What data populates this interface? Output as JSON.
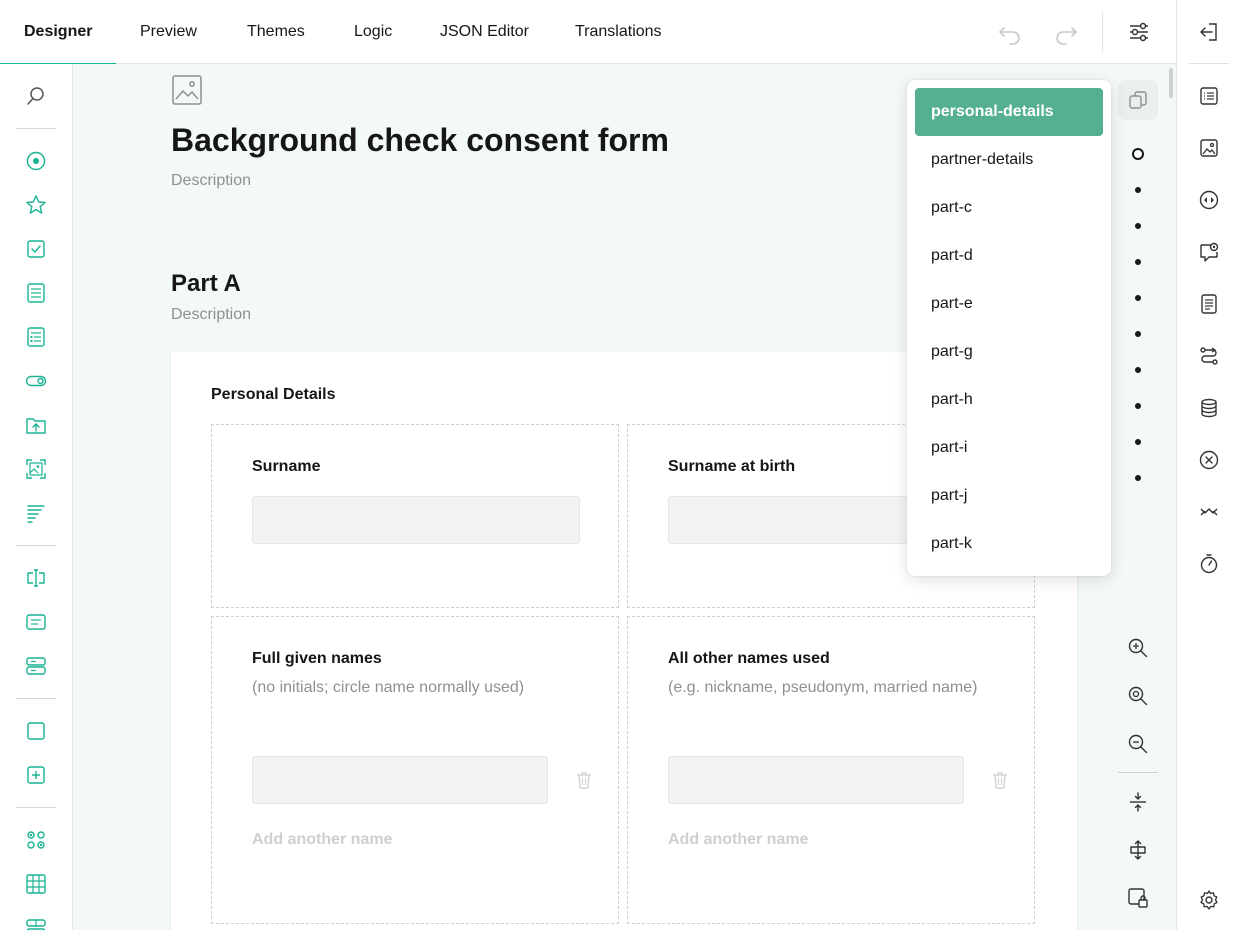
{
  "colors": {
    "accent": "#19b394",
    "selected_item": "#55b092",
    "canvas_bg": "#f3f9f8"
  },
  "tabs": [
    {
      "label": "Designer",
      "active": true
    },
    {
      "label": "Preview",
      "active": false
    },
    {
      "label": "Themes",
      "active": false
    },
    {
      "label": "Logic",
      "active": false
    },
    {
      "label": "JSON Editor",
      "active": false
    },
    {
      "label": "Translations",
      "active": false
    }
  ],
  "top_actions": [
    "undo-icon",
    "redo-icon",
    "settings-sliders-icon"
  ],
  "toolbox_icons": [
    "search-icon",
    "radiogroup-icon",
    "rating-star-icon",
    "checkbox-icon",
    "dropdown-icon",
    "tagbox-icon",
    "boolean-toggle-icon",
    "file-upload-icon",
    "image-picker-icon",
    "ranking-icon",
    "single-input-icon",
    "comment-icon",
    "multiple-text-icon",
    "panel-icon",
    "panel-dynamic-icon",
    "matrix-icon",
    "matrix-grid-icon",
    "matrix-dynamic-icon"
  ],
  "form": {
    "title": "Background check consent form",
    "description": "Description"
  },
  "page": {
    "title": "Part A",
    "description": "Description"
  },
  "panel": {
    "title": "Personal Details",
    "questions": [
      {
        "title": "Surname",
        "description": ""
      },
      {
        "title": "Surname at birth",
        "description": ""
      },
      {
        "title": "Full given names",
        "description": "(no initials; circle name normally used)",
        "add_label": "Add another name"
      },
      {
        "title": "All other names used",
        "description": "(e.g. nickname, pseudonym, married name)",
        "add_label": "Add another name"
      }
    ]
  },
  "page_dropdown": {
    "items": [
      "personal-details",
      "partner-details",
      "part-c",
      "part-d",
      "part-e",
      "part-g",
      "part-h",
      "part-i",
      "part-j",
      "part-k"
    ],
    "selected": "personal-details"
  },
  "page_nav_dots": 10,
  "zoom_tools": [
    "zoom-in-icon",
    "zoom-to-fit-icon",
    "zoom-out-icon",
    "collapse-icon",
    "expand-icon",
    "lock-icon"
  ],
  "right_sidebar_icons": [
    "exit-icon",
    "general-list-icon",
    "logo-image-icon",
    "navigation-icon",
    "question-settings-icon",
    "pages-icon",
    "logic-icon",
    "data-icon",
    "validation-icon",
    "show-on-completed-icon",
    "timer-icon",
    "gear-icon"
  ]
}
